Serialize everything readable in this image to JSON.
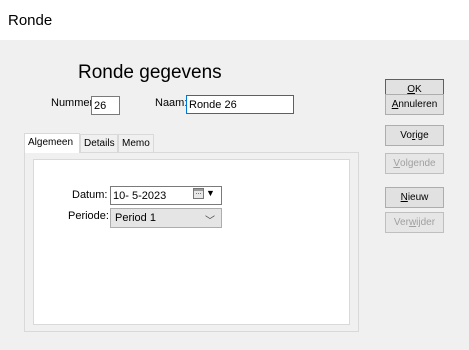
{
  "window": {
    "title": "Ronde"
  },
  "heading": "Ronde gegevens",
  "fields": {
    "nummer_label": "Nummer:",
    "nummer_value": "26",
    "naam_label": "Naam:",
    "naam_value": "Ronde 26"
  },
  "tabs": [
    {
      "label": "Algemeen",
      "active": true
    },
    {
      "label": "Details",
      "active": false
    },
    {
      "label": "Memo",
      "active": false
    }
  ],
  "general": {
    "datum_label": "Datum:",
    "datum_value": "10- 5-2023",
    "periode_label": "Periode:",
    "periode_value": "Period 1",
    "calendar_icon": "calendar-icon",
    "dropdown_icon": "chevron-down-icon"
  },
  "buttons": {
    "ok": {
      "pre": "",
      "accel": "O",
      "post": "K",
      "enabled": true
    },
    "annuleren": {
      "pre": "",
      "accel": "A",
      "post": "nnuleren",
      "enabled": true
    },
    "vorige": {
      "pre": "Vo",
      "accel": "r",
      "post": "ige",
      "enabled": true
    },
    "volgende": {
      "pre": "",
      "accel": "V",
      "post": "olgende",
      "enabled": false
    },
    "nieuw": {
      "pre": "",
      "accel": "N",
      "post": "ieuw",
      "enabled": true
    },
    "verwijder": {
      "pre": "Ver",
      "accel": "w",
      "post": "ijder",
      "enabled": false
    }
  },
  "colors": {
    "window_bg": "#f0f0f0",
    "focus_border": "#0078d7",
    "disabled_text": "#a0a0a0"
  }
}
